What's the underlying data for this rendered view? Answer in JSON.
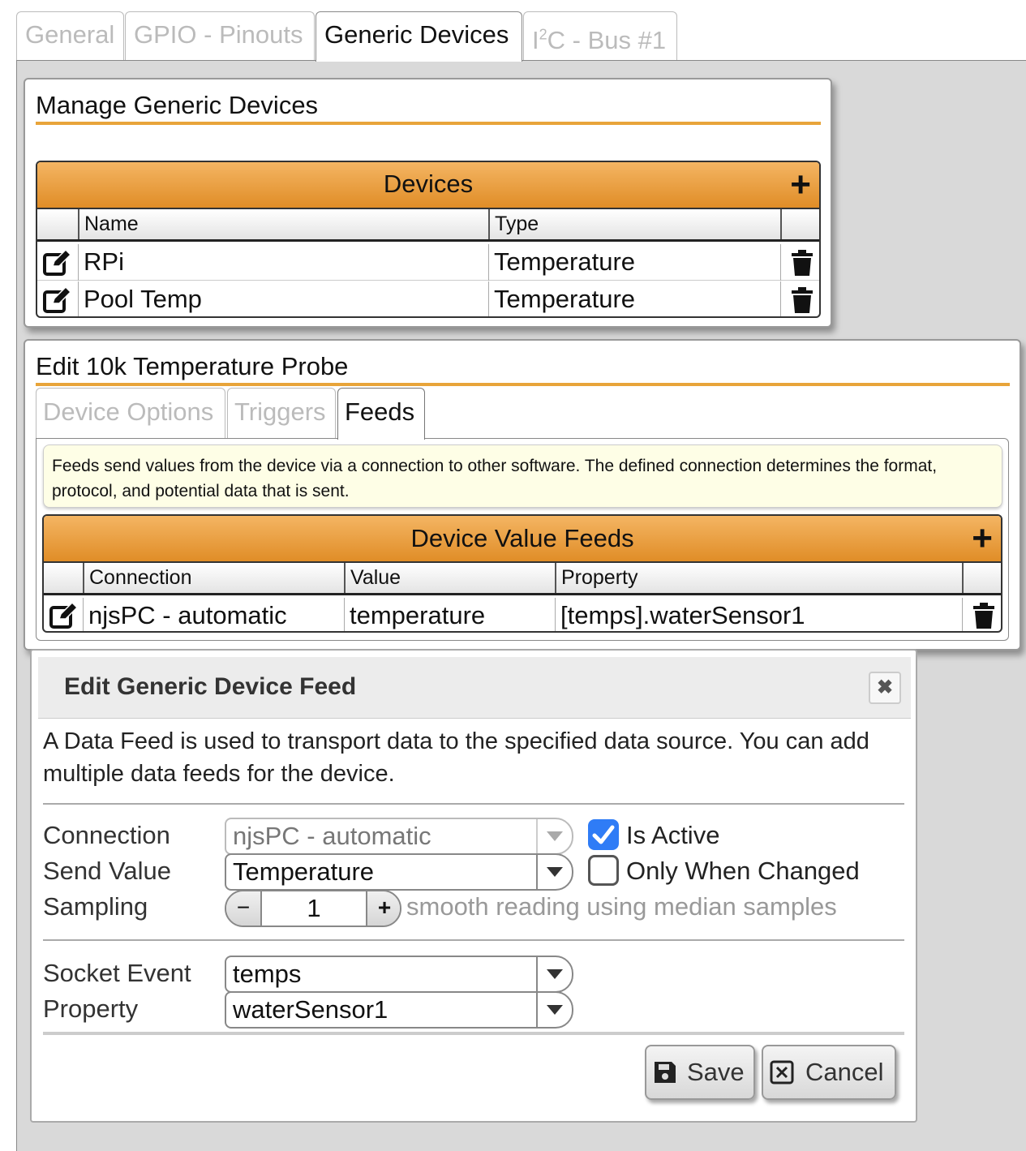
{
  "tabs": [
    {
      "label": "General",
      "active": false
    },
    {
      "label": "GPIO - Pinouts",
      "active": false
    },
    {
      "label": "Generic Devices",
      "active": true
    },
    {
      "label": "I2C - Bus #1",
      "active": false
    }
  ],
  "manage": {
    "title": "Manage Generic Devices",
    "grid_title": "Devices",
    "columns": [
      "Name",
      "Type"
    ],
    "rows": [
      {
        "name": "RPi",
        "type": "Temperature"
      },
      {
        "name": "Pool Temp",
        "type": "Temperature"
      }
    ]
  },
  "edit_probe": {
    "title": "Edit 10k Temperature Probe",
    "tabs": [
      "Device Options",
      "Triggers",
      "Feeds"
    ],
    "active_tab": "Feeds",
    "note": "Feeds send values from the device via a connection to other software. The defined connection determines the format, protocol, and potential data that is sent.",
    "grid_title": "Device Value Feeds",
    "columns": [
      "Connection",
      "Value",
      "Property"
    ],
    "rows": [
      {
        "connection": "njsPC - automatic",
        "value": "temperature",
        "property": "[temps].waterSensor1"
      }
    ]
  },
  "dialog": {
    "title": "Edit Generic Device Feed",
    "description": "A Data Feed is used to transport data to the specified data source. You can add multiple data feeds for the device.",
    "connection_label": "Connection",
    "connection_value": "njsPC - automatic",
    "send_value_label": "Send Value",
    "send_value": "Temperature",
    "sampling_label": "Sampling",
    "sampling_value": "1",
    "sampling_hint": "smooth reading using median samples",
    "is_active_label": "Is Active",
    "is_active": true,
    "only_changed_label": "Only When Changed",
    "only_changed": false,
    "socket_event_label": "Socket Event",
    "socket_event_value": "temps",
    "property_label": "Property",
    "property_value": "waterSensor1",
    "save_label": "Save",
    "cancel_label": "Cancel"
  },
  "colors": {
    "accent": "#e8a43a",
    "grid_header": "#e08d27",
    "checkbox": "#2f7cf6",
    "note_bg": "#fefee6"
  }
}
